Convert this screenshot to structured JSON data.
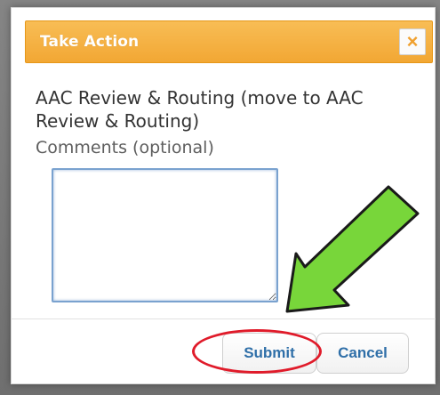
{
  "dialog": {
    "title": "Take Action",
    "close_label": "×",
    "heading": "AAC Review & Routing (move to AAC Review & Routing)",
    "comments_label": "Comments (optional)",
    "comments_value": ""
  },
  "actions": {
    "submit_label": "Submit",
    "cancel_label": "Cancel"
  },
  "colors": {
    "title_bar": "#f2a734",
    "button_text": "#2f6fa8",
    "highlight": "#e01b2a",
    "arrow_fill": "#78d63a",
    "arrow_stroke": "#1a1a1a",
    "close_x": "#f0a02e"
  },
  "icons": {
    "close": "close-icon",
    "annotation_arrow": "arrow-icon",
    "resize_handle": "resize-grip-icon"
  }
}
